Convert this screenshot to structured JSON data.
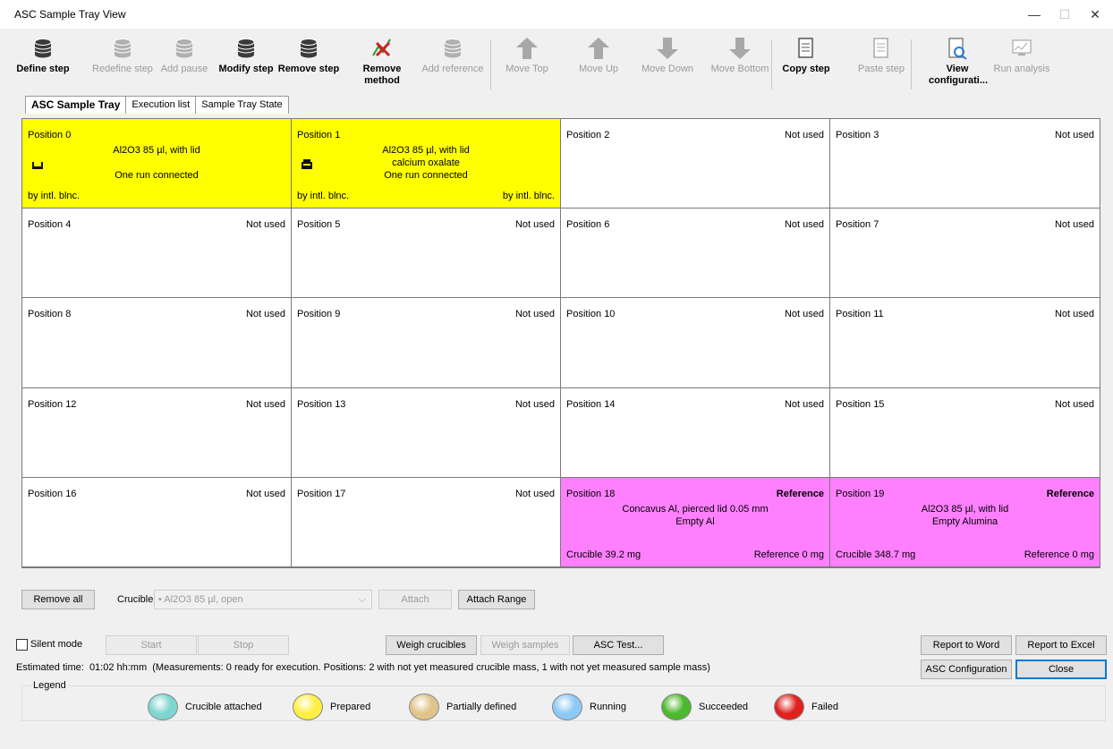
{
  "window": {
    "title": "ASC Sample Tray View",
    "minimize": "—",
    "maximize": "☐",
    "close": "✕"
  },
  "toolbar": [
    {
      "label": "Define step",
      "icon": "define-step-icon",
      "enabled": true,
      "bold": true
    },
    {
      "label": "Redefine step",
      "icon": "redefine-step-icon",
      "enabled": false
    },
    {
      "label": "Add pause",
      "icon": "add-pause-icon",
      "enabled": false
    },
    {
      "label": "Modify step",
      "icon": "modify-step-icon",
      "enabled": true,
      "bold": true
    },
    {
      "label": "Remove step",
      "icon": "remove-step-icon",
      "enabled": true,
      "bold": true
    },
    {
      "label": "Remove method",
      "icon": "remove-method-icon",
      "enabled": true,
      "bold": true
    },
    {
      "label": "Add reference",
      "icon": "add-reference-icon",
      "enabled": false
    },
    {
      "label": "Move Top",
      "icon": "move-top-icon",
      "enabled": false
    },
    {
      "label": "Move Up",
      "icon": "move-up-icon",
      "enabled": false
    },
    {
      "label": "Move Down",
      "icon": "move-down-icon",
      "enabled": false
    },
    {
      "label": "Move Bottom",
      "icon": "move-bottom-icon",
      "enabled": false
    },
    {
      "label": "Copy step",
      "icon": "copy-step-icon",
      "enabled": true,
      "bold": true
    },
    {
      "label": "Paste step",
      "icon": "paste-step-icon",
      "enabled": false
    },
    {
      "label": "View configurati...",
      "icon": "view-configuration-icon",
      "enabled": true,
      "bold": true
    },
    {
      "label": "Run analysis",
      "icon": "run-analysis-icon",
      "enabled": false
    }
  ],
  "tabs": [
    "ASC Sample Tray",
    "Execution list",
    "Sample Tray State"
  ],
  "tray": {
    "positions": [
      {
        "name": "Position 0",
        "status": "",
        "lines": [
          "Al2O3 85 µl, with lid",
          "",
          "One run connected"
        ],
        "bottom_left": "by intl. blnc.",
        "bottom_right": "",
        "color": "yellow",
        "crucible_icon": "open"
      },
      {
        "name": "Position 1",
        "status": "",
        "lines": [
          "Al2O3 85 µl, with lid",
          "calcium oxalate",
          "One run connected"
        ],
        "bottom_left": "by intl. blnc.",
        "bottom_right": "by intl. blnc.",
        "color": "yellow",
        "crucible_icon": "closed"
      },
      {
        "name": "Position 2",
        "status": "Not used"
      },
      {
        "name": "Position 3",
        "status": "Not used"
      },
      {
        "name": "Position 4",
        "status": "Not used"
      },
      {
        "name": "Position 5",
        "status": "Not used"
      },
      {
        "name": "Position 6",
        "status": "Not used"
      },
      {
        "name": "Position 7",
        "status": "Not used"
      },
      {
        "name": "Position 8",
        "status": "Not used"
      },
      {
        "name": "Position 9",
        "status": "Not used"
      },
      {
        "name": "Position 10",
        "status": "Not used"
      },
      {
        "name": "Position 11",
        "status": "Not used"
      },
      {
        "name": "Position 12",
        "status": "Not used"
      },
      {
        "name": "Position 13",
        "status": "Not used"
      },
      {
        "name": "Position 14",
        "status": "Not used"
      },
      {
        "name": "Position 15",
        "status": "Not used"
      },
      {
        "name": "Position 16",
        "status": "Not used"
      },
      {
        "name": "Position 17",
        "status": "Not used"
      },
      {
        "name": "Position 18",
        "status": "Reference",
        "lines": [
          "Concavus Al, pierced lid 0.05 mm",
          "Empty Al"
        ],
        "bottom_left": "Crucible 39.2 mg",
        "bottom_right": "Reference 0 mg",
        "color": "magenta"
      },
      {
        "name": "Position 19",
        "status": "Reference",
        "lines": [
          "Al2O3 85 µl, with lid",
          "Empty Alumina"
        ],
        "bottom_left": "Crucible 348.7 mg",
        "bottom_right": "Reference 0 mg",
        "color": "magenta"
      }
    ]
  },
  "controls": {
    "remove_all": "Remove all",
    "crucible_label": "Crucible",
    "crucible_value": "• Al2O3 85 µl, open",
    "attach": "Attach",
    "attach_range": "Attach Range",
    "silent_mode": "Silent mode",
    "start": "Start",
    "stop": "Stop",
    "weigh_crucibles": "Weigh crucibles",
    "weigh_samples": "Weigh samples",
    "asc_test": "ASC Test...",
    "report_word": "Report to Word",
    "report_excel": "Report to Excel",
    "asc_config": "ASC Configuration",
    "close": "Close",
    "estimated_label": "Estimated time:",
    "estimated_value": "01:02 hh:mm",
    "estimated_info": "(Measurements: 0 ready for execution. Positions: 2 with not yet measured crucible mass, 1 with not yet measured sample mass)"
  },
  "legend": {
    "title": "Legend",
    "items": [
      {
        "label": "Crucible attached",
        "color": "#7fd6d0"
      },
      {
        "label": "Prepared",
        "color": "#ffee44"
      },
      {
        "label": "Partially defined",
        "color": "#e0c48a"
      },
      {
        "label": "Running",
        "color": "#8ccaf5"
      },
      {
        "label": "Succeeded",
        "color": "#4cb82e"
      },
      {
        "label": "Failed",
        "color": "#e0201c"
      }
    ]
  }
}
